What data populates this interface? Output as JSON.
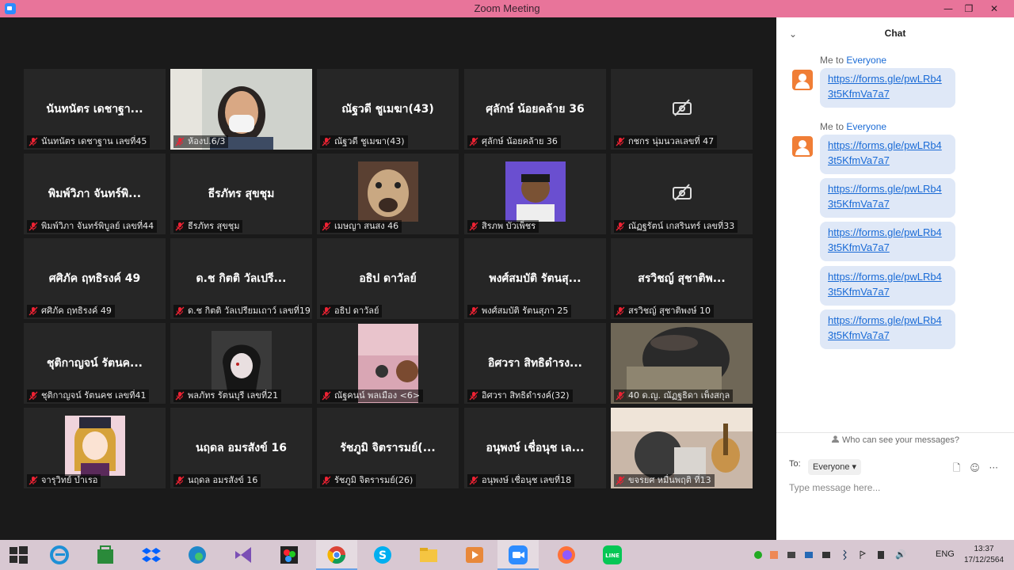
{
  "window": {
    "title": "Zoom Meeting",
    "minimize": "—",
    "restore": "❐",
    "close": "✕"
  },
  "participants": [
    {
      "big": "นันทนัตร เดชาฐา...",
      "name": "นันทนัตร เดชาฐาน เลขที่45"
    },
    {
      "big": "",
      "name": "ห้องป.6/3"
    },
    {
      "big": "ณัฐวดี ชูเมฆา(43)",
      "name": "ณัฐวดี ชูเมฆา(43)"
    },
    {
      "big": "ศุลักษ์ น้อยคล้าย 36",
      "name": "ศุลักษ์ น้อยคล้าย 36"
    },
    {
      "big": "",
      "name": "กชกร นุ่มนวลเลขที่ 47"
    },
    {
      "big": "พิมพ์วิภา จันทร์พิ...",
      "name": "พิมพ์วิภา จันทร์พิบูลย์ เลขที่44"
    },
    {
      "big": "ธีรภัทร สุขชุม",
      "name": "ธีรภัทร สุขชุม"
    },
    {
      "big": "",
      "name": "เมษญา สนสง 46"
    },
    {
      "big": "",
      "name": "สิรภพ บัวเพ็ชร"
    },
    {
      "big": "",
      "name": "ณัฏฐรัตน์ เกสรินทร์ เลขที่33"
    },
    {
      "big": "ศศิภัค ฤทธิรงค์ 49",
      "name": "ศศิภัค ฤทธิรงค์ 49"
    },
    {
      "big": "ด.ช กิตติ วัลเปรี...",
      "name": "ด.ช กิตติ วัลเปรียมเถาว์ เลขที่19"
    },
    {
      "big": "อธิป ดาวัลย์",
      "name": "อธิป ดาวัลย์"
    },
    {
      "big": "พงศ์สมบัติ รัตนสุ...",
      "name": "พงศ์สมบัติ รัตนสุภา 25"
    },
    {
      "big": "สรวิชญ์ สุชาติพ...",
      "name": "สรวิชญ์ สุชาติพงษ์ 10"
    },
    {
      "big": "ชุติกาญจน์ รัตนค...",
      "name": "ชุติกาญจน์ รัตนคช เลขที่41"
    },
    {
      "big": "",
      "name": "พลภัทร รัตนบุรี เลขที่21"
    },
    {
      "big": "",
      "name": "ณัฐคนน์ พลเมือง <6>"
    },
    {
      "big": "อิศวรา สิทธิดำรง...",
      "name": "อิศวรา สิทธิดำรงค์(32)"
    },
    {
      "big": "",
      "name": "40 ด.ญ. ณัฏฐธิดา เพ็งสกุล"
    },
    {
      "big": "",
      "name": "จารุวิทย์ บำเรอ"
    },
    {
      "big": "นฤดล อมรสังข์ 16",
      "name": "นฤดล อมรสังข์ 16"
    },
    {
      "big": "รัชภูมิ จิตรารมย์(...",
      "name": "รัชภูมิ จิตรารมย์(26)"
    },
    {
      "big": "อนุพงษ์ เชื่อนุช เล...",
      "name": "อนุพงษ์ เชื่อนุช เลขที่18"
    },
    {
      "big": "",
      "name": "ขจรยศ หมื่นพฤติ ที่13"
    }
  ],
  "chat": {
    "title": "Chat",
    "collapse_icon": "⌄",
    "messages": [
      {
        "from": "Me to ",
        "to": "Everyone",
        "links": [
          "https://forms.gle/pwLRb43t5KfmVa7a7"
        ]
      },
      {
        "from": "Me to ",
        "to": "Everyone",
        "links": [
          "https://forms.gle/pwLRb43t5KfmVa7a7",
          "https://forms.gle/pwLRb43t5KfmVa7a7",
          "https://forms.gle/pwLRb43t5KfmVa7a7",
          "https://forms.gle/pwLRb43t5KfmVa7a7",
          "https://forms.gle/pwLRb43t5KfmVa7a7"
        ]
      }
    ],
    "who_can_see": "Who can see your messages?",
    "to_label": "To:",
    "recipient": "Everyone",
    "placeholder": "Type message here...",
    "file_icon": "🗋",
    "emoji_icon": "☺",
    "more_icon": "···"
  },
  "taskbar": {
    "language": "ENG",
    "time": "13:37",
    "date": "17/12/2564",
    "accent": "#6aa1e6"
  }
}
